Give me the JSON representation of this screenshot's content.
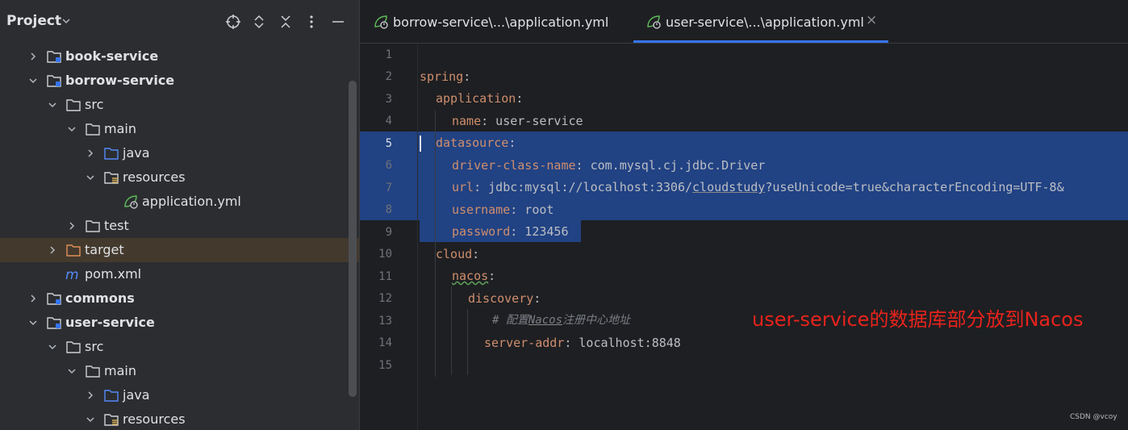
{
  "project_panel": {
    "title": "Project",
    "tree": [
      {
        "label": "book-service",
        "type": "module",
        "expanded": false
      },
      {
        "label": "borrow-service",
        "type": "module",
        "expanded": true
      },
      {
        "label": "src",
        "type": "folder",
        "expanded": true
      },
      {
        "label": "main",
        "type": "folder",
        "expanded": true
      },
      {
        "label": "java",
        "type": "source-folder",
        "expanded": false
      },
      {
        "label": "resources",
        "type": "resources-folder",
        "expanded": true
      },
      {
        "label": "application.yml",
        "type": "yml-file"
      },
      {
        "label": "test",
        "type": "folder",
        "expanded": false
      },
      {
        "label": "target",
        "type": "excluded-folder",
        "expanded": false,
        "selected": true
      },
      {
        "label": "pom.xml",
        "type": "maven-file"
      },
      {
        "label": "commons",
        "type": "module",
        "expanded": false
      },
      {
        "label": "user-service",
        "type": "module",
        "expanded": true
      },
      {
        "label": "src",
        "type": "folder",
        "expanded": true
      },
      {
        "label": "main",
        "type": "folder",
        "expanded": true
      },
      {
        "label": "java",
        "type": "source-folder",
        "expanded": false
      },
      {
        "label": "resources",
        "type": "resources-folder",
        "expanded": true
      }
    ],
    "header_icons": [
      "locate-icon",
      "expand-all-icon",
      "collapse-all-icon",
      "options-icon",
      "hide-icon"
    ]
  },
  "editor": {
    "tabs": [
      {
        "label": "borrow-service\\...\\application.yml",
        "active": false
      },
      {
        "label": "user-service\\...\\application.yml",
        "active": true
      }
    ],
    "close_glyph": "×",
    "current_line": 5,
    "line_numbers": [
      "1",
      "2",
      "3",
      "4",
      "5",
      "6",
      "7",
      "8",
      "9",
      "10",
      "11",
      "12",
      "13",
      "14",
      "15"
    ],
    "lines": {
      "l2": {
        "key": "spring",
        "sep": ":"
      },
      "l3": {
        "key": "application",
        "sep": ":"
      },
      "l4": {
        "key": "name",
        "sep": ":",
        "value": " user-service"
      },
      "l5": {
        "key": "datasource",
        "sep": ":"
      },
      "l6": {
        "key": "driver-class-name",
        "sep": ":",
        "value": " com.mysql.cj.jdbc.Driver"
      },
      "l7": {
        "key": "url",
        "sep": ":",
        "value_a": " jdbc:mysql://localhost:3306/",
        "value_b": "cloudstudy",
        "value_c": "?useUnicode=true&characterEncoding=UTF-8&"
      },
      "l8": {
        "key": "username",
        "sep": ":",
        "value": " root"
      },
      "l9": {
        "key": "password",
        "sep": ":",
        "value": " 123456"
      },
      "l10": {
        "key": "cloud",
        "sep": ":"
      },
      "l11": {
        "key": "nacos",
        "sep": ":"
      },
      "l12": {
        "key": "discovery",
        "sep": ":"
      },
      "l13": {
        "hash": "# ",
        "comment_a": "配置",
        "comment_b": "Nacos",
        "comment_c": "注册中心地址"
      },
      "l14": {
        "key": "server-addr",
        "sep": ":",
        "value": " localhost:8848"
      }
    }
  },
  "annotation": "user-service的数据库部分放到Nacos",
  "watermark": "CSDN @vcoy",
  "colors": {
    "key": "#cf8e6d",
    "value": "#bcbec4",
    "comment": "#7a7e85",
    "selection": "#214283",
    "annotation": "#e8231c",
    "tab_underline": "#3574f0"
  }
}
